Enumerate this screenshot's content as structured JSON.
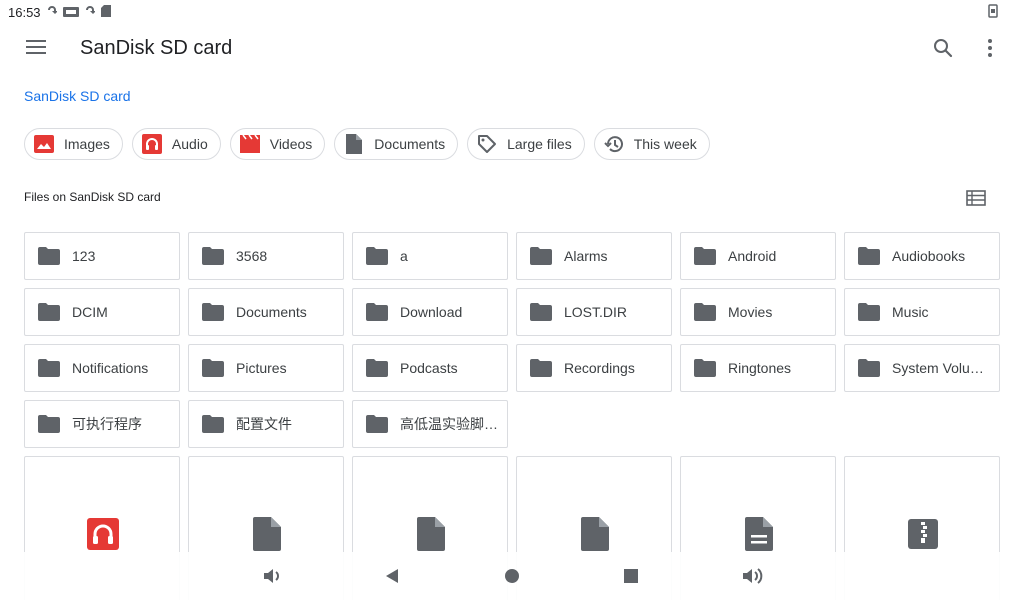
{
  "status_bar": {
    "time": "16:53",
    "icons": [
      "sync-icon",
      "dvr-icon",
      "sync-icon",
      "sd-card-icon"
    ],
    "right_icon": "rotate-icon"
  },
  "app_bar": {
    "title": "SanDisk SD card",
    "menu_icon": "menu-icon",
    "search_icon": "search-icon",
    "more_icon": "more-vert-icon"
  },
  "breadcrumb": "SanDisk SD card",
  "chips": [
    {
      "label": "Images",
      "icon": "image-icon"
    },
    {
      "label": "Audio",
      "icon": "headphones-icon"
    },
    {
      "label": "Videos",
      "icon": "movie-icon"
    },
    {
      "label": "Documents",
      "icon": "document-icon"
    },
    {
      "label": "Large files",
      "icon": "tag-icon"
    },
    {
      "label": "This week",
      "icon": "history-icon"
    }
  ],
  "section_label": "Files on SanDisk SD card",
  "folders": [
    "123",
    "3568",
    "a",
    "Alarms",
    "Android",
    "Audiobooks",
    "DCIM",
    "Documents",
    "Download",
    "LOST.DIR",
    "Movies",
    "Music",
    "Notifications",
    "Pictures",
    "Podcasts",
    "Recordings",
    "Ringtones",
    "System Volu…",
    "可执行程序",
    "配置文件",
    "高低温实验脚…"
  ],
  "files": [
    {
      "icon": "audio-file-icon"
    },
    {
      "icon": "file-icon"
    },
    {
      "icon": "file-icon"
    },
    {
      "icon": "file-icon"
    },
    {
      "icon": "text-file-icon"
    },
    {
      "icon": "zip-file-icon"
    }
  ],
  "nav_bar": [
    "volume-down-icon",
    "back-icon",
    "home-icon",
    "recents-icon",
    "volume-up-icon"
  ],
  "colors": {
    "accent": "#1a73e8",
    "icon_grey": "#5f6368",
    "red_icon": "#e53935",
    "border": "#dadce0"
  }
}
